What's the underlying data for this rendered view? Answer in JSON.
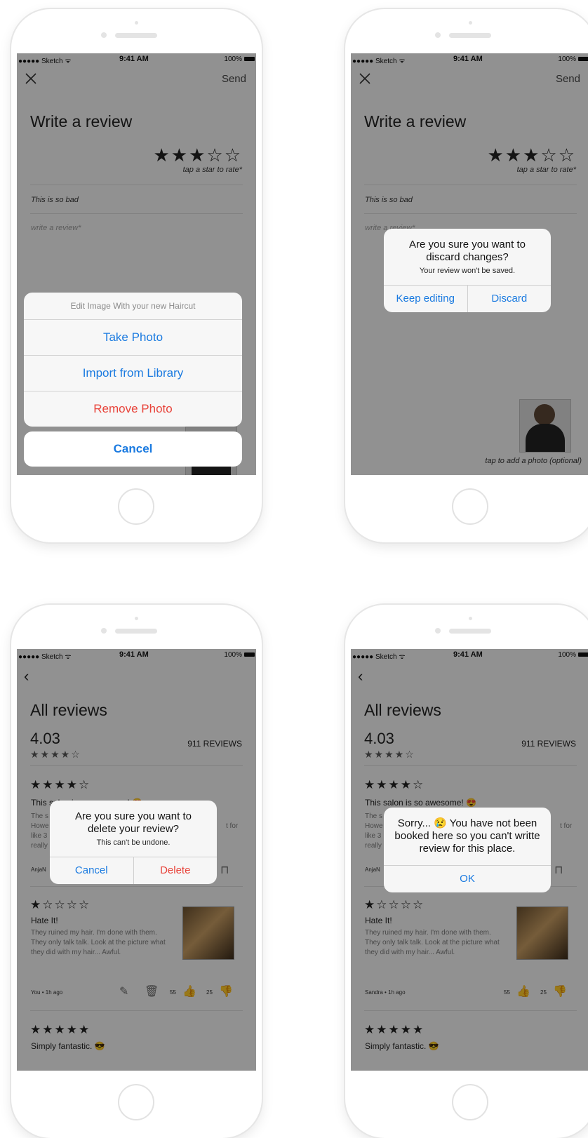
{
  "status_bar": {
    "carrier": "●●●●● Sketch ᯤ",
    "time": "9:41 AM",
    "battery": "100%"
  },
  "screen1": {
    "send_label": "Send",
    "title": "Write a review",
    "stars": "★★★☆☆",
    "hint": "tap a star to rate*",
    "review_title": "This is so bad",
    "review_placeholder": "write a review*",
    "sheet_header": "Edit Image With your new Haircut",
    "take_photo": "Take Photo",
    "import_library": "Import from Library",
    "remove_photo": "Remove Photo",
    "cancel": "Cancel"
  },
  "screen2": {
    "send_label": "Send",
    "title": "Write a review",
    "stars": "★★★☆☆",
    "hint": "tap a star to rate*",
    "review_title": "This is so bad",
    "review_placeholder": "write a review*",
    "alert_title": "Are you sure you want to discard changes?",
    "alert_message": "Your review won't be saved.",
    "keep_editing": "Keep editing",
    "discard": "Discard",
    "photo_hint": "tap to add a photo (optional)"
  },
  "screen3": {
    "title": "All reviews",
    "rating": "4.03",
    "rating_stars": "★★★★☆",
    "reviews_count": "911 REVIEWS",
    "review1": {
      "stars": "★★★★☆",
      "title": "This salon is so awesome! 😍",
      "body_partial": "The s\nHowe\nlike 3\nreally",
      "author": "AnjaN",
      "trailing": "t for"
    },
    "alert_title": "Are you sure you want to delete your review?",
    "alert_message": "This can't be undone.",
    "cancel": "Cancel",
    "delete": "Delete",
    "review2": {
      "stars": "★☆☆☆☆",
      "title": "Hate It!",
      "body": "They ruined my hair. I'm done with them. They only talk talk. Look at the picture what they did with my hair... Awful.",
      "author": "You • 1h ago",
      "likes": "55",
      "dislikes": "25"
    },
    "review3": {
      "stars": "★★★★★",
      "title": "Simply fantastic. 😎"
    }
  },
  "screen4": {
    "title": "All reviews",
    "rating": "4.03",
    "rating_stars": "★★★★☆",
    "reviews_count": "911 REVIEWS",
    "review1": {
      "stars": "★★★★☆",
      "title": "This salon is so awesome! 😍",
      "body_partial": "The s\nHowe\nlike 3\nreally",
      "author": "AnjaN",
      "trailing": "t for"
    },
    "alert_title": "Sorry... 😢 You have not been booked here so you can't writte review for this place.",
    "ok": "OK",
    "review2": {
      "stars": "★☆☆☆☆",
      "title": "Hate It!",
      "body": "They ruined my hair. I'm done with them. They only talk talk. Look at the picture what they did with my hair... Awful.",
      "author": "Sandra • 1h ago",
      "likes": "55",
      "dislikes": "25"
    },
    "review3": {
      "stars": "★★★★★",
      "title": "Simply fantastic. 😎"
    }
  }
}
